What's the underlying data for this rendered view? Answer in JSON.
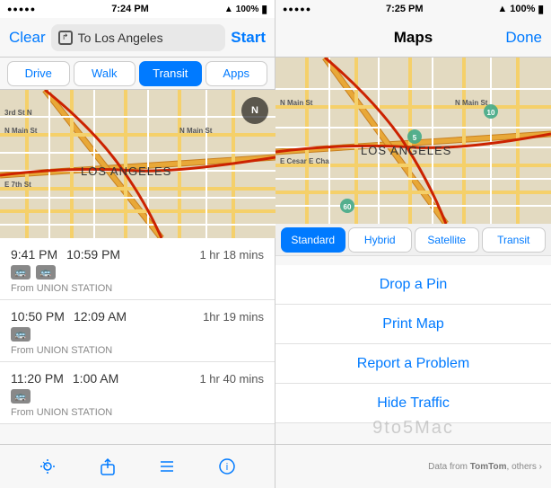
{
  "left": {
    "statusBar": {
      "signal": "●●●●●",
      "time": "7:24 PM",
      "arrow": "▲",
      "battery": "100%",
      "batteryIcon": "🔋"
    },
    "navBar": {
      "clear": "Clear",
      "destination": "To Los Angeles",
      "start": "Start"
    },
    "tabs": [
      {
        "label": "Drive",
        "active": false
      },
      {
        "label": "Walk",
        "active": false
      },
      {
        "label": "Transit",
        "active": true
      },
      {
        "label": "Apps",
        "active": false
      }
    ],
    "compass": "N",
    "routes": [
      {
        "depart": "9:41 PM",
        "arrive": "10:59 PM",
        "duration": "1 hr 18 mins",
        "icons": [
          "bus",
          "bus"
        ],
        "from": "From UNION STATION"
      },
      {
        "depart": "10:50 PM",
        "arrive": "12:09 AM",
        "duration": "1hr 19 mins",
        "icons": [
          "bus"
        ],
        "from": "From UNION STATION"
      },
      {
        "depart": "11:20 PM",
        "arrive": "1:00 AM",
        "duration": "1 hr 40 mins",
        "icons": [
          "bus"
        ],
        "from": "From UNION STATION"
      }
    ],
    "toolbar": {
      "location": "⬆",
      "share": "⬆",
      "list": "☰",
      "info": "ℹ"
    }
  },
  "right": {
    "statusBar": {
      "signal": "●●●●●",
      "time": "7:25 PM",
      "arrow": "▲",
      "battery": "100%"
    },
    "navBar": {
      "title": "Maps",
      "done": "Done"
    },
    "mapTypes": [
      {
        "label": "Standard",
        "active": true
      },
      {
        "label": "Hybrid",
        "active": false
      },
      {
        "label": "Satellite",
        "active": false
      },
      {
        "label": "Transit",
        "active": false
      }
    ],
    "menuItems": [
      "Drop a Pin",
      "Print Map",
      "Report a Problem",
      "Hide Traffic"
    ],
    "watermark": "9to5Mac",
    "attribution": "Data from TomTom, others ›"
  }
}
